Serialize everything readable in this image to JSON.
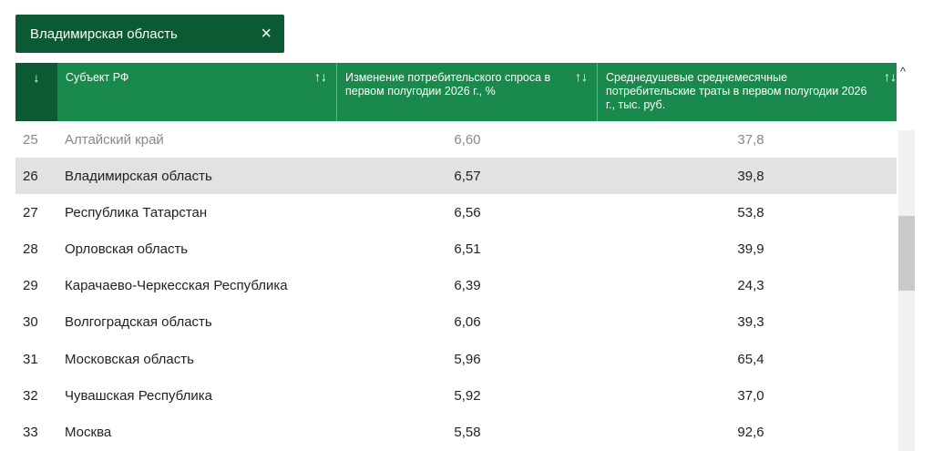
{
  "filter": {
    "label": "Владимирская область",
    "close_icon": "×"
  },
  "table": {
    "select_arrow": "↓",
    "sort_icon": "↑↓",
    "headers": [
      "Субъект РФ",
      "Изменение потребительского спроса в первом полугодии 2026 г., %",
      "Среднедушевые среднемесячные потребительские траты в первом полугодии 2026 г., тыс. руб."
    ],
    "rows": [
      {
        "rank": "25",
        "name": "Алтайский край",
        "change": "6,60",
        "spend": "37,8"
      },
      {
        "rank": "26",
        "name": "Владимирская область",
        "change": "6,57",
        "spend": "39,8"
      },
      {
        "rank": "27",
        "name": "Республика Татарстан",
        "change": "6,56",
        "spend": "53,8"
      },
      {
        "rank": "28",
        "name": "Орловская область",
        "change": "6,51",
        "spend": "39,9"
      },
      {
        "rank": "29",
        "name": "Карачаево-Черкесская Республика",
        "change": "6,39",
        "spend": "24,3"
      },
      {
        "rank": "30",
        "name": "Волгоградская область",
        "change": "6,06",
        "spend": "39,3"
      },
      {
        "rank": "31",
        "name": "Московская область",
        "change": "5,96",
        "spend": "65,4"
      },
      {
        "rank": "32",
        "name": "Чувашская Республика",
        "change": "5,92",
        "spend": "37,0"
      },
      {
        "rank": "33",
        "name": "Москва",
        "change": "5,58",
        "spend": "92,6"
      }
    ]
  },
  "scrollbar": {
    "up_icon": "^"
  },
  "colors": {
    "header_green": "#1a8a4c",
    "dark_green": "#0c5a34",
    "highlight_row": "#e2e2e2"
  }
}
